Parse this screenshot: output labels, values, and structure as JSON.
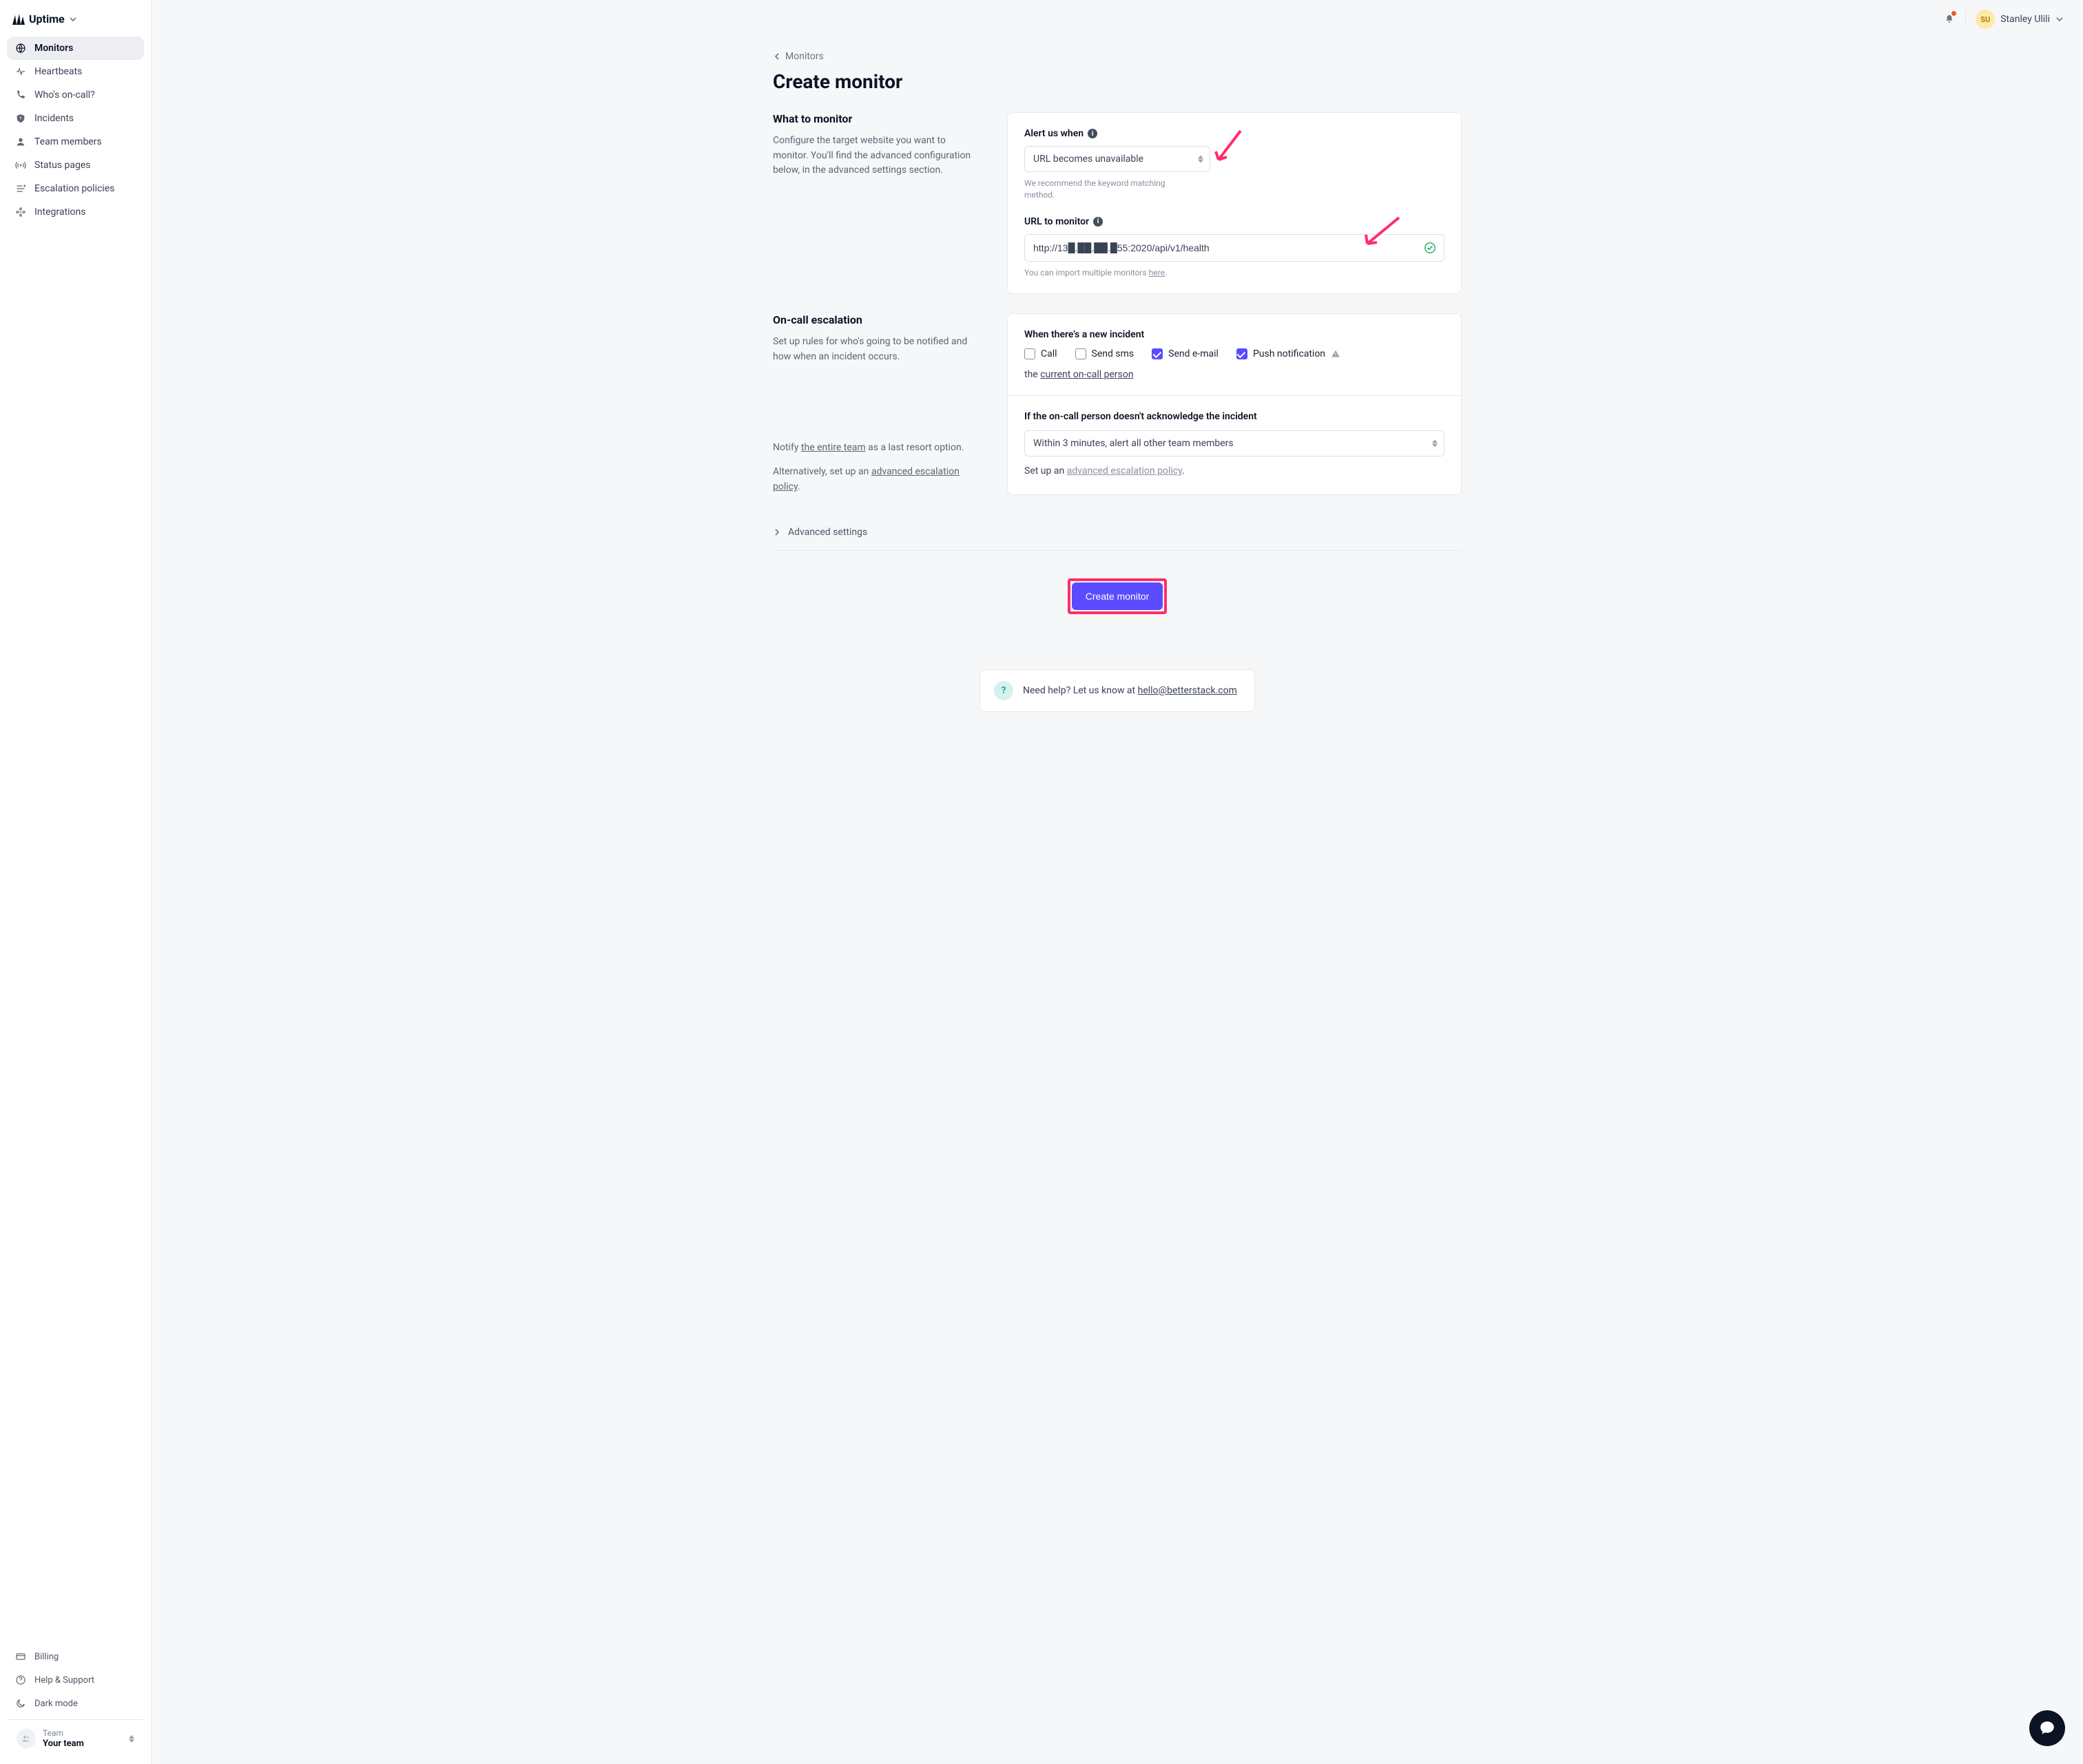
{
  "brand": {
    "name": "Uptime"
  },
  "user": {
    "initials": "SU",
    "name": "Stanley Ulili"
  },
  "sidebar": {
    "items": [
      {
        "label": "Monitors",
        "active": true
      },
      {
        "label": "Heartbeats"
      },
      {
        "label": "Who's on-call?"
      },
      {
        "label": "Incidents"
      },
      {
        "label": "Team members"
      },
      {
        "label": "Status pages"
      },
      {
        "label": "Escalation policies"
      },
      {
        "label": "Integrations"
      }
    ],
    "bottom": [
      {
        "label": "Billing"
      },
      {
        "label": "Help & Support"
      },
      {
        "label": "Dark mode"
      }
    ],
    "team": {
      "caption": "Team",
      "name": "Your team"
    }
  },
  "breadcrumb": "Monitors",
  "page_title": "Create monitor",
  "sec1": {
    "title": "What to monitor",
    "desc": "Configure the target website you want to monitor. You'll find the advanced configuration below, in the advanced settings section.",
    "alert_label": "Alert us when",
    "alert_value": "URL becomes unavailable",
    "alert_helper": "We recommend the keyword matching method.",
    "url_label": "URL to monitor",
    "url_value": "http://13█.██.██.█55:2020/api/v1/health",
    "url_helper_prefix": "You can import multiple monitors ",
    "url_helper_link": "here"
  },
  "sec2": {
    "title": "On-call escalation",
    "desc": "Set up rules for who's going to be notified and how when an incident occurs.",
    "incident_heading": "When there's a new incident",
    "cb_call": "Call",
    "cb_sms": "Send sms",
    "cb_email": "Send e-mail",
    "cb_push": "Push notification",
    "current_prefix": "the ",
    "current_link": "current on-call person",
    "ack_heading": "If the on-call person doesn't acknowledge the incident",
    "ack_value": "Within 3 minutes, alert all other team members",
    "ack_helper_prefix": "Set up an ",
    "ack_helper_link": "advanced escalation policy",
    "notify_prefix": "Notify ",
    "notify_link": "the entire team",
    "notify_suffix": " as a last resort option.",
    "alt_prefix": "Alternatively, set up an ",
    "alt_link": "advanced escalation policy"
  },
  "advanced": "Advanced settings",
  "submit": "Create monitor",
  "help": {
    "prefix": "Need help? Let us know at ",
    "email": "hello@betterstack.com"
  }
}
